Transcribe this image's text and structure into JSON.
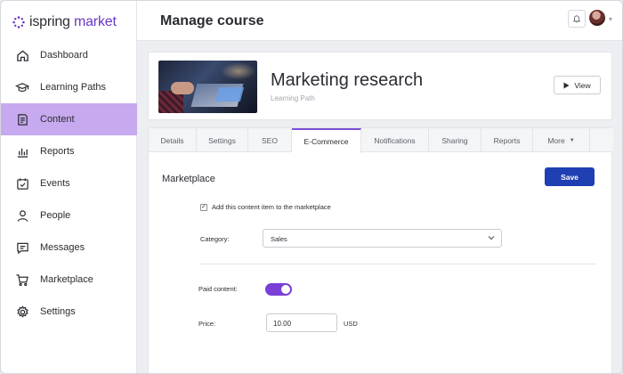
{
  "app": {
    "logo_text_brand": "ispring",
    "logo_text_product": "market"
  },
  "sidebar": {
    "items": [
      {
        "label": "Dashboard",
        "icon": "home-icon",
        "active": false
      },
      {
        "label": "Learning Paths",
        "icon": "graduation-cap-icon",
        "active": false
      },
      {
        "label": "Content",
        "icon": "document-icon",
        "active": true
      },
      {
        "label": "Reports",
        "icon": "bar-chart-icon",
        "active": false
      },
      {
        "label": "Events",
        "icon": "calendar-check-icon",
        "active": false
      },
      {
        "label": "People",
        "icon": "person-icon",
        "active": false
      },
      {
        "label": "Messages",
        "icon": "message-icon",
        "active": false
      },
      {
        "label": "Marketplace",
        "icon": "cart-icon",
        "active": false
      },
      {
        "label": "Settings",
        "icon": "gear-icon",
        "active": false
      }
    ]
  },
  "header": {
    "title": "Manage course"
  },
  "course": {
    "title": "Marketing research",
    "type": "Learning Path",
    "view_label": "View"
  },
  "tabs": [
    {
      "label": "Details",
      "active": false
    },
    {
      "label": "Settings",
      "active": false
    },
    {
      "label": "SEO",
      "active": false
    },
    {
      "label": "E-Commerce",
      "active": true
    },
    {
      "label": "Notifications",
      "active": false
    },
    {
      "label": "Sharing",
      "active": false
    },
    {
      "label": "Reports",
      "active": false
    },
    {
      "label": "More",
      "active": false
    }
  ],
  "marketplace": {
    "section_title": "Marketplace",
    "save_label": "Save",
    "add_to_marketplace_label": "Add this content item to the marketplace",
    "add_to_marketplace_checked": true,
    "category_label": "Category:",
    "category_value": "Sales",
    "paid_content_label": "Paid content:",
    "paid_content_enabled": true,
    "price_label": "Price:",
    "price_value": "10.00",
    "currency": "USD"
  },
  "colors": {
    "accent_purple": "#7a3fd6",
    "active_nav_bg": "#c6a9ee",
    "save_button_blue": "#1f3fb3"
  }
}
